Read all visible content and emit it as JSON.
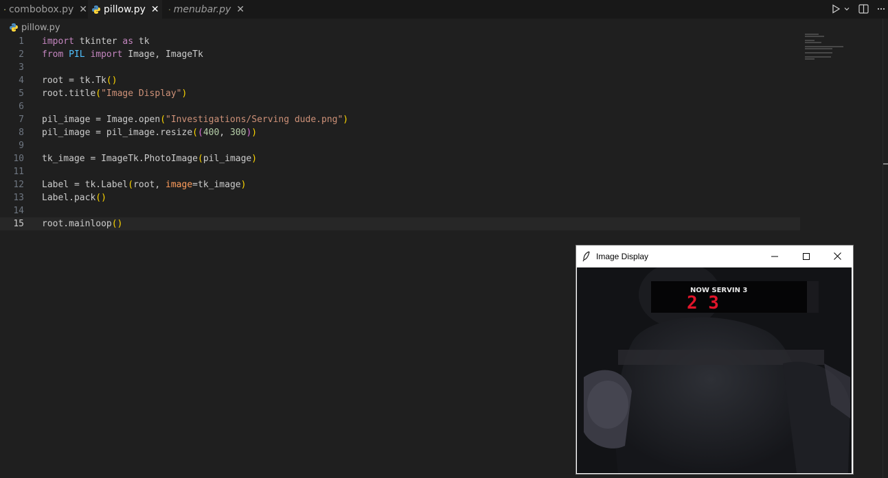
{
  "tabs": [
    {
      "label": "combobox.py",
      "close": "✕"
    },
    {
      "label": "pillow.py",
      "close": "✕"
    },
    {
      "label": "menubar.py",
      "close": "✕"
    }
  ],
  "breadcrumb": {
    "file": "pillow.py"
  },
  "editor": {
    "line_numbers": [
      "1",
      "2",
      "3",
      "4",
      "5",
      "6",
      "7",
      "8",
      "9",
      "10",
      "11",
      "12",
      "13",
      "14",
      "15"
    ],
    "current_line": "15"
  },
  "tk_window": {
    "title": "Image Display",
    "image_text_top": "NOW SERVIN 3",
    "image_text_number": "2 3"
  },
  "colors": {
    "editor_bg": "#1f1f1f",
    "keyword": "#c586c0",
    "string": "#ce9178",
    "number": "#b5cea8",
    "bracket": "#ffd700"
  },
  "icons": [
    "python-file-icon",
    "close-icon",
    "run-icon",
    "chevron-down-icon",
    "split-editor-icon",
    "more-icon",
    "tk-feather-icon",
    "minimize-icon",
    "maximize-icon",
    "window-close-icon"
  ]
}
